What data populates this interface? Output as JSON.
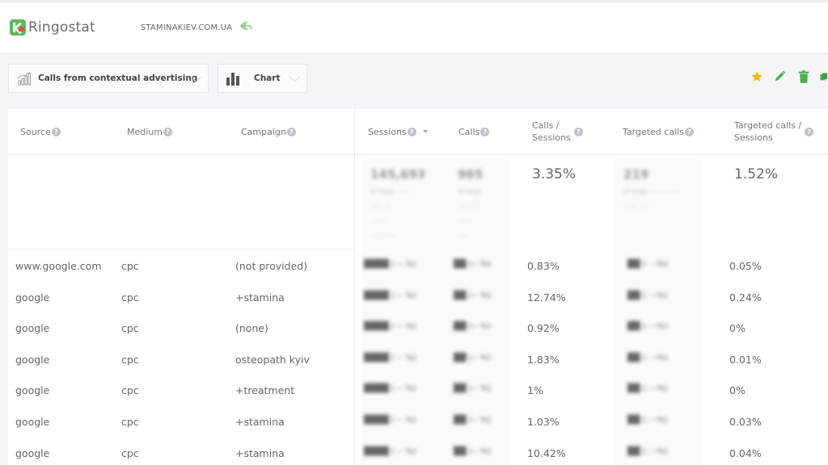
{
  "app": {
    "brand": "Ringostat",
    "site": "STAMINAKIEV.COM.UA",
    "brand_color": "#5cb85c",
    "accent_color": "#e74c3c"
  },
  "toolbar": {
    "report_select": {
      "icon": "growth-chart-icon",
      "value": "Calls from contextual advertising"
    },
    "view_select": {
      "icon": "bar-chart-icon",
      "value": "Chart"
    },
    "actions": [
      {
        "name": "favorite",
        "icon": "star-icon",
        "color": "#f5b800"
      },
      {
        "name": "edit",
        "icon": "pencil-icon",
        "color": "#4caf50"
      },
      {
        "name": "delete",
        "icon": "trash-icon",
        "color": "#4caf50"
      },
      {
        "name": "copy",
        "icon": "copy-icon",
        "color": "#4caf50"
      }
    ]
  },
  "table": {
    "columns": [
      {
        "key": "source",
        "label": "Source",
        "help": "?"
      },
      {
        "key": "medium",
        "label": "Medium",
        "help": "?"
      },
      {
        "key": "campaign",
        "label": "Campaign",
        "help": "?"
      },
      {
        "key": "sessions",
        "label": "Sessions",
        "help": "?",
        "sorted": "desc"
      },
      {
        "key": "calls",
        "label": "Calls",
        "help": "?"
      },
      {
        "key": "calls_sessions",
        "label_1": "Calls /",
        "label_2": "Sessions",
        "help": "?"
      },
      {
        "key": "targeted_calls",
        "label": "Targeted calls",
        "help": "?"
      },
      {
        "key": "targeted_sessions",
        "label_1": "Targeted calls /",
        "label_2": "Sessions",
        "help": "?"
      }
    ],
    "totals": {
      "sessions": "[redacted]",
      "calls": "[redacted]",
      "calls_sessions": "3.35%",
      "targeted_calls": "[redacted]",
      "targeted_sessions": "1.52%"
    },
    "rows": [
      {
        "source": "www.google.com",
        "medium": "cpc",
        "campaign": "(not provided)",
        "sessions": "[redacted]",
        "calls": "[redacted]",
        "calls_sessions": "0.83%",
        "targeted_calls": "[redacted]",
        "targeted_sessions": "0.05%"
      },
      {
        "source": "google",
        "medium": "cpc",
        "campaign": "+stamina",
        "sessions": "[redacted]",
        "calls": "[redacted]",
        "calls_sessions": "12.74%",
        "targeted_calls": "[redacted]",
        "targeted_sessions": "0.24%"
      },
      {
        "source": "google",
        "medium": "cpc",
        "campaign": "(none)",
        "sessions": "[redacted]",
        "calls": "[redacted]",
        "calls_sessions": "0.92%",
        "targeted_calls": "[redacted]",
        "targeted_sessions": "0%"
      },
      {
        "source": "google",
        "medium": "cpc",
        "campaign": "osteopath kyiv",
        "sessions": "[redacted]",
        "calls": "[redacted]",
        "calls_sessions": "1.83%",
        "targeted_calls": "[redacted]",
        "targeted_sessions": "0.01%"
      },
      {
        "source": "google",
        "medium": "cpc",
        "campaign": "+treatment",
        "sessions": "[redacted]",
        "calls": "[redacted]",
        "calls_sessions": "1%",
        "targeted_calls": "[redacted]",
        "targeted_sessions": "0%"
      },
      {
        "source": "google",
        "medium": "cpc",
        "campaign": "+stamina",
        "sessions": "[redacted]",
        "calls": "[redacted]",
        "calls_sessions": "1.03%",
        "targeted_calls": "[redacted]",
        "targeted_sessions": "0.03%"
      },
      {
        "source": "google",
        "medium": "cpc",
        "campaign": "+stamina",
        "sessions": "[redacted]",
        "calls": "[redacted]",
        "calls_sessions": "10.42%",
        "targeted_calls": "[redacted]",
        "targeted_sessions": "0.04%"
      }
    ]
  }
}
